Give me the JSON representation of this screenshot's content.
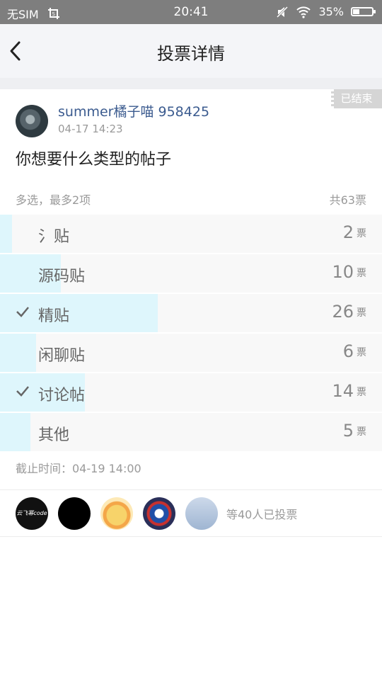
{
  "status_bar": {
    "carrier": "无SIM",
    "time": "20:41",
    "battery": "35%",
    "battery_level": 0.35
  },
  "nav": {
    "title": "投票详情"
  },
  "post": {
    "ended_tag": "已结束",
    "username": "summer橘子喵 958425",
    "time": "04-17 14:23",
    "question": "你想要什么类型的帖子"
  },
  "vote": {
    "mode": "多选，最多2项",
    "total": "共63票",
    "unit": "票",
    "options": [
      {
        "label": "氵贴",
        "count": "2",
        "fraction": 0.032,
        "checked": false
      },
      {
        "label": "源码贴",
        "count": "10",
        "fraction": 0.159,
        "checked": false
      },
      {
        "label": "精贴",
        "count": "26",
        "fraction": 0.413,
        "checked": true
      },
      {
        "label": "闲聊贴",
        "count": "6",
        "fraction": 0.095,
        "checked": false
      },
      {
        "label": "讨论帖",
        "count": "14",
        "fraction": 0.222,
        "checked": true
      },
      {
        "label": "其他",
        "count": "5",
        "fraction": 0.079,
        "checked": false
      }
    ],
    "deadline": "截止时间：04-19 14:00"
  },
  "voters": {
    "avatar1_text": "云飞幂code",
    "summary": "等40人已投票"
  }
}
